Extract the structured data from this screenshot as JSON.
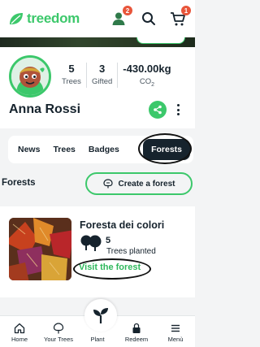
{
  "header": {
    "logo_text": "treedom",
    "profile_badge": "2",
    "cart_badge": "1",
    "icons": [
      "leaf-logo-icon",
      "user-icon",
      "search-icon",
      "cart-icon"
    ]
  },
  "profile": {
    "name": "Anna Rossi",
    "stats": [
      {
        "value": "5",
        "label": "Trees"
      },
      {
        "value": "3",
        "label": "Gifted"
      },
      {
        "value": "-430.00kg",
        "label": "CO",
        "label_sub": "2"
      }
    ]
  },
  "tabs": {
    "items": [
      "News",
      "Trees",
      "Badges"
    ],
    "active": "Forests"
  },
  "forests": {
    "section_title": "Forests",
    "create_label": "Create a forest",
    "card": {
      "name": "Foresta dei colori",
      "tree_count": "5",
      "trees_label": "Trees planted",
      "visit_label": "Visit the forest"
    }
  },
  "bottom_nav": {
    "items": [
      "Home",
      "Your Trees",
      "Plant",
      "Redeem",
      "Menù"
    ]
  },
  "colors": {
    "brand_green": "#3cc86b",
    "dark": "#16232d",
    "badge_red": "#e8553a"
  }
}
